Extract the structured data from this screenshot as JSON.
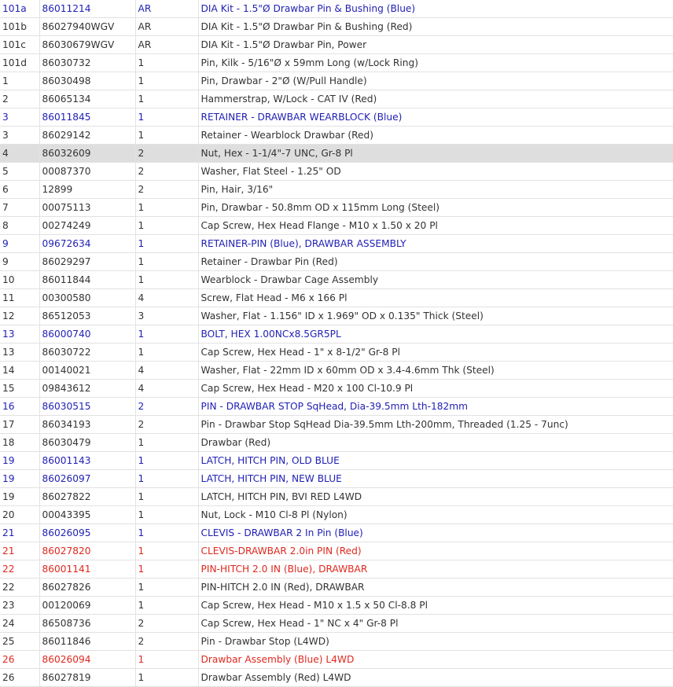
{
  "colors": {
    "blue_row": "#1f1fb5",
    "red_row": "#e0281e",
    "highlight": "#dedede",
    "text": "#333333"
  },
  "rows": [
    {
      "ref": "101a",
      "part": "86011214",
      "qty": "AR",
      "desc": "DIA Kit - 1.5\"Ø Drawbar Pin & Bushing (Blue)",
      "style": "blue"
    },
    {
      "ref": "101b",
      "part": "86027940WGV",
      "qty": "AR",
      "desc": "DIA Kit - 1.5\"Ø Drawbar Pin & Bushing (Red)",
      "style": ""
    },
    {
      "ref": "101c",
      "part": "86030679WGV",
      "qty": "AR",
      "desc": "DIA Kit - 1.5\"Ø Drawbar Pin, Power",
      "style": ""
    },
    {
      "ref": "101d",
      "part": "86030732",
      "qty": "1",
      "desc": "Pin, Kilk - 5/16\"Ø x 59mm Long (w/Lock Ring)",
      "style": ""
    },
    {
      "ref": "1",
      "part": "86030498",
      "qty": "1",
      "desc": "Pin, Drawbar - 2\"Ø (W/Pull Handle)",
      "style": ""
    },
    {
      "ref": "2",
      "part": "86065134",
      "qty": "1",
      "desc": "Hammerstrap, W/Lock - CAT IV (Red)",
      "style": ""
    },
    {
      "ref": "3",
      "part": "86011845",
      "qty": "1",
      "desc": "RETAINER - DRAWBAR WEARBLOCK (Blue)",
      "style": "blue"
    },
    {
      "ref": "3",
      "part": "86029142",
      "qty": "1",
      "desc": "Retainer - Wearblock Drawbar (Red)",
      "style": ""
    },
    {
      "ref": "4",
      "part": "86032609",
      "qty": "2",
      "desc": "Nut, Hex - 1-1/4\"-7 UNC, Gr-8 Pl",
      "style": "hl"
    },
    {
      "ref": "5",
      "part": "00087370",
      "qty": "2",
      "desc": "Washer, Flat Steel - 1.25\" OD",
      "style": ""
    },
    {
      "ref": "6",
      "part": "12899",
      "qty": "2",
      "desc": "Pin, Hair, 3/16\"",
      "style": ""
    },
    {
      "ref": "7",
      "part": "00075113",
      "qty": "1",
      "desc": "Pin, Drawbar - 50.8mm OD x 115mm Long (Steel)",
      "style": ""
    },
    {
      "ref": "8",
      "part": "00274249",
      "qty": "1",
      "desc": "Cap Screw, Hex Head Flange - M10 x 1.50 x 20 Pl",
      "style": ""
    },
    {
      "ref": "9",
      "part": "09672634",
      "qty": "1",
      "desc": "RETAINER-PIN (Blue), DRAWBAR ASSEMBLY",
      "style": "blue"
    },
    {
      "ref": "9",
      "part": "86029297",
      "qty": "1",
      "desc": "Retainer - Drawbar Pin (Red)",
      "style": ""
    },
    {
      "ref": "10",
      "part": "86011844",
      "qty": "1",
      "desc": "Wearblock - Drawbar Cage Assembly",
      "style": ""
    },
    {
      "ref": "11",
      "part": "00300580",
      "qty": "4",
      "desc": "Screw, Flat Head - M6 x 166 Pl",
      "style": ""
    },
    {
      "ref": "12",
      "part": "86512053",
      "qty": "3",
      "desc": "Washer, Flat - 1.156\" ID x 1.969\" OD x 0.135\" Thick (Steel)",
      "style": ""
    },
    {
      "ref": "13",
      "part": "86000740",
      "qty": "1",
      "desc": "BOLT, HEX 1.00NCx8.5GR5PL",
      "style": "blue"
    },
    {
      "ref": "13",
      "part": "86030722",
      "qty": "1",
      "desc": "Cap Screw, Hex Head - 1\" x 8-1/2\" Gr-8 Pl",
      "style": ""
    },
    {
      "ref": "14",
      "part": "00140021",
      "qty": "4",
      "desc": "Washer, Flat - 22mm ID x 60mm OD x 3.4-4.6mm Thk (Steel)",
      "style": ""
    },
    {
      "ref": "15",
      "part": "09843612",
      "qty": "4",
      "desc": "Cap Screw, Hex Head - M20 x 100 Cl-10.9 Pl",
      "style": ""
    },
    {
      "ref": "16",
      "part": "86030515",
      "qty": "2",
      "desc": "PIN - DRAWBAR STOP SqHead, Dia-39.5mm Lth-182mm",
      "style": "blue"
    },
    {
      "ref": "17",
      "part": "86034193",
      "qty": "2",
      "desc": "Pin - Drawbar Stop SqHead Dia-39.5mm Lth-200mm, Threaded (1.25 - 7unc)",
      "style": ""
    },
    {
      "ref": "18",
      "part": "86030479",
      "qty": "1",
      "desc": "Drawbar (Red)",
      "style": ""
    },
    {
      "ref": "19",
      "part": "86001143",
      "qty": "1",
      "desc": "LATCH, HITCH PIN, OLD BLUE",
      "style": "blue"
    },
    {
      "ref": "19",
      "part": "86026097",
      "qty": "1",
      "desc": "LATCH, HITCH PIN, NEW BLUE",
      "style": "blue"
    },
    {
      "ref": "19",
      "part": "86027822",
      "qty": "1",
      "desc": "LATCH, HITCH PIN, BVI RED L4WD",
      "style": ""
    },
    {
      "ref": "20",
      "part": "00043395",
      "qty": "1",
      "desc": "Nut, Lock - M10 Cl-8 Pl (Nylon)",
      "style": ""
    },
    {
      "ref": "21",
      "part": "86026095",
      "qty": "1",
      "desc": "CLEVIS - DRAWBAR 2 In Pin (Blue)",
      "style": "blue"
    },
    {
      "ref": "21",
      "part": "86027820",
      "qty": "1",
      "desc": "CLEVIS-DRAWBAR 2.0in PIN (Red)",
      "style": "red"
    },
    {
      "ref": "22",
      "part": "86001141",
      "qty": "1",
      "desc": "PIN-HITCH 2.0 IN (Blue), DRAWBAR",
      "style": "red"
    },
    {
      "ref": "22",
      "part": "86027826",
      "qty": "1",
      "desc": "PIN-HITCH 2.0 IN (Red), DRAWBAR",
      "style": ""
    },
    {
      "ref": "23",
      "part": "00120069",
      "qty": "1",
      "desc": "Cap Screw, Hex Head - M10 x 1.5 x 50 Cl-8.8 Pl",
      "style": ""
    },
    {
      "ref": "24",
      "part": "86508736",
      "qty": "2",
      "desc": "Cap Screw, Hex Head - 1\" NC x 4\" Gr-8 Pl",
      "style": ""
    },
    {
      "ref": "25",
      "part": "86011846",
      "qty": "2",
      "desc": "Pin - Drawbar Stop (L4WD)",
      "style": ""
    },
    {
      "ref": "26",
      "part": "86026094",
      "qty": "1",
      "desc": "Drawbar Assembly (Blue) L4WD",
      "style": "red"
    },
    {
      "ref": "26",
      "part": "86027819",
      "qty": "1",
      "desc": "Drawbar Assembly (Red) L4WD",
      "style": ""
    }
  ]
}
